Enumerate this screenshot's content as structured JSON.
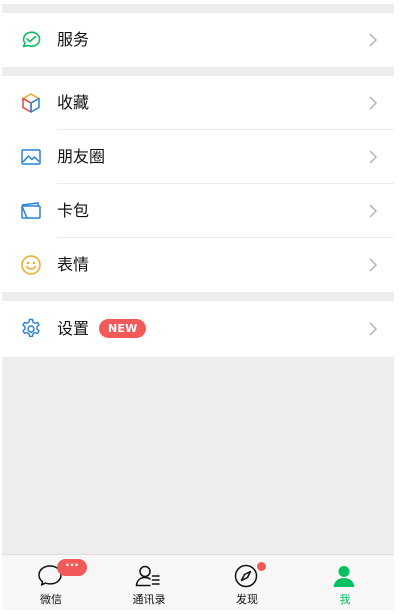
{
  "menu": {
    "services": {
      "label": "服务",
      "icon": "services-icon"
    },
    "favorites": {
      "label": "收藏",
      "icon": "favorites-cube-icon"
    },
    "moments": {
      "label": "朋友圈",
      "icon": "moments-image-icon"
    },
    "cards": {
      "label": "卡包",
      "icon": "card-wallet-icon"
    },
    "stickers": {
      "label": "表情",
      "icon": "smiley-icon"
    },
    "settings": {
      "label": "设置",
      "icon": "gear-icon",
      "badge": "NEW"
    }
  },
  "tabbar": {
    "chats": {
      "label": "微信",
      "badge": "···"
    },
    "contacts": {
      "label": "通讯录"
    },
    "discover": {
      "label": "发现",
      "has_dot": true
    },
    "me": {
      "label": "我",
      "active": true
    }
  },
  "colors": {
    "accent": "#07c160",
    "badge": "#f25a5a",
    "background": "#ededed"
  }
}
